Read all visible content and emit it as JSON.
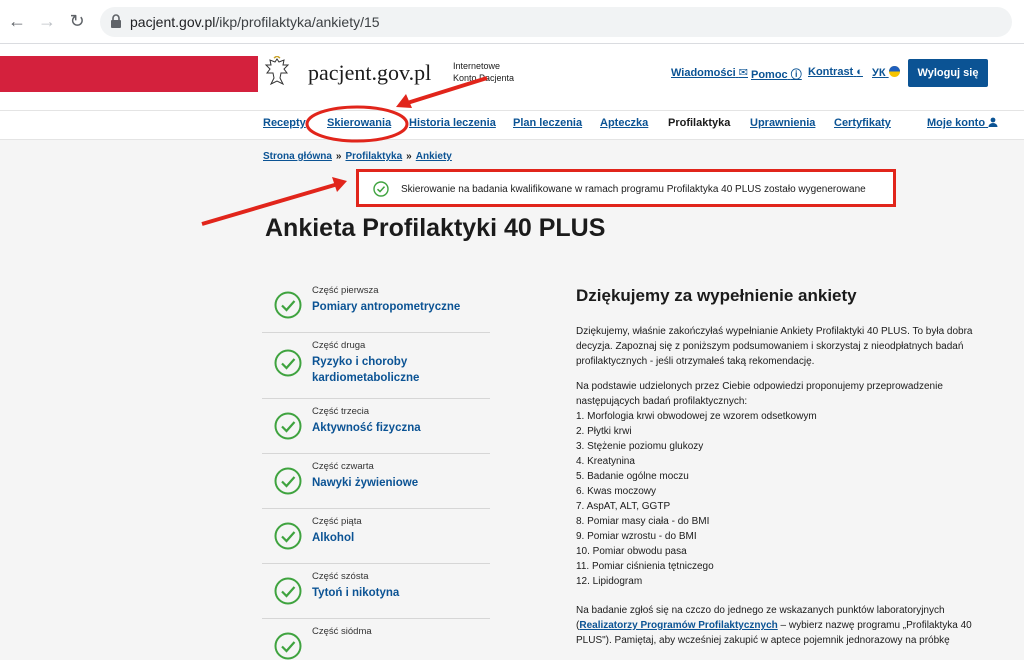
{
  "browser": {
    "url_domain": "pacjent.gov.pl",
    "url_path": "/ikp/profilaktyka/ankiety/15"
  },
  "header": {
    "logo": "pacjent.gov.pl",
    "subtitle_line1": "Internetowe",
    "subtitle_line2": "Konto Pacjenta",
    "links": {
      "messages": "Wiadomości",
      "help": "Pomoc",
      "contrast": "Kontrast",
      "language": "УК"
    },
    "logout": "Wyloguj się"
  },
  "nav": {
    "items": [
      {
        "label": "Recepty"
      },
      {
        "label": "Skierowania"
      },
      {
        "label": "Historia leczenia"
      },
      {
        "label": "Plan leczenia"
      },
      {
        "label": "Apteczka"
      },
      {
        "label": "Profilaktyka"
      },
      {
        "label": "Uprawnienia"
      },
      {
        "label": "Certyfikaty"
      },
      {
        "label": "Moje konto"
      }
    ]
  },
  "breadcrumb": {
    "home": "Strona główna",
    "sep": "»",
    "section": "Profilaktyka",
    "current": "Ankiety"
  },
  "notice": {
    "text": "Skierowanie na badania kwalifikowane w ramach programu Profilaktyka 40 PLUS zostało wygenerowane"
  },
  "page_title": "Ankieta Profilaktyki 40 PLUS",
  "steps": [
    {
      "part": "Część pierwsza",
      "title": "Pomiary antropometryczne"
    },
    {
      "part": "Część druga",
      "title": "Ryzyko i choroby kardiometaboliczne"
    },
    {
      "part": "Część trzecia",
      "title": "Aktywność fizyczna"
    },
    {
      "part": "Część czwarta",
      "title": "Nawyki żywieniowe"
    },
    {
      "part": "Część piąta",
      "title": "Alkohol"
    },
    {
      "part": "Część szósta",
      "title": "Tytoń i nikotyna"
    },
    {
      "part": "Część siódma",
      "title": ""
    }
  ],
  "content": {
    "title": "Dziękujemy za wypełnienie ankiety",
    "intro": "Dziękujemy, właśnie zakończyłaś wypełnianie Ankiety Profilaktyki 40 PLUS. To była dobra decyzja. Zapoznaj się z poniższym podsumowaniem i skorzystaj z nieodpłatnych badań profilaktycznych - jeśli otrzymałeś taką rekomendację.",
    "proposal": "Na podstawie udzielonych przez Ciebie odpowiedzi proponujemy przeprowadzenie następujących badań profilaktycznych:",
    "tests": [
      "1. Morfologia krwi obwodowej ze wzorem odsetkowym",
      "2. Płytki krwi",
      "3. Stężenie poziomu glukozy",
      "4. Kreatynina",
      "5. Badanie ogólne moczu",
      "6. Kwas moczowy",
      "7. AspAT, ALT, GGTP",
      "8. Pomiar masy ciała - do BMI",
      "9. Pomiar wzrostu - do BMI",
      "10. Pomiar obwodu pasa",
      "11. Pomiar ciśnienia tętniczego",
      "12. Lipidogram"
    ],
    "footer_before": "Na badanie zgłoś się na czczo do jednego ze wskazanych punktów laboratoryjnych (",
    "footer_link": "Realizatorzy Programów Profilaktycznych",
    "footer_after": " – wybierz nazwę programu „Profilaktyka 40 PLUS\"). Pamiętaj, aby wcześniej zakupić w aptece pojemnik jednorazowy na próbkę"
  },
  "colors": {
    "link": "#0b5394",
    "brand_red": "#d4213d",
    "success_green": "#3fa33f",
    "annotation_red": "#e1251b"
  }
}
